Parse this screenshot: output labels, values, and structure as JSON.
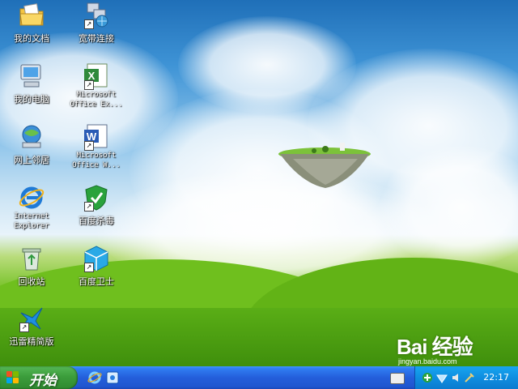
{
  "desktop_icons": [
    {
      "label": "我的文档",
      "icon": "my-documents-folder-icon",
      "shortcut": false
    },
    {
      "label": "宽带连接",
      "icon": "broadband-connection-icon",
      "shortcut": true
    },
    {
      "label": "我的电脑",
      "icon": "my-computer-icon",
      "shortcut": false
    },
    {
      "label": "Microsoft Office Ex...",
      "icon": "microsoft-excel-icon",
      "shortcut": true
    },
    {
      "label": "网上邻居",
      "icon": "network-places-icon",
      "shortcut": false
    },
    {
      "label": "Microsoft Office W...",
      "icon": "microsoft-word-icon",
      "shortcut": true
    },
    {
      "label": "Internet Explorer",
      "icon": "internet-explorer-icon",
      "shortcut": false
    },
    {
      "label": "百度杀毒",
      "icon": "baidu-antivirus-icon",
      "shortcut": true
    },
    {
      "label": "回收站",
      "icon": "recycle-bin-icon",
      "shortcut": false
    },
    {
      "label": "百度卫士",
      "icon": "baidu-guard-icon",
      "shortcut": true
    },
    {
      "label": "迅雷精简版",
      "icon": "xunlei-icon",
      "shortcut": true
    }
  ],
  "taskbar": {
    "start_label": "开始",
    "quick_launch": [
      "internet-explorer-icon",
      "show-desktop-icon"
    ],
    "tray_icons": [
      "keyboard-icon",
      "baidu-antivirus-tray-icon",
      "network-tray-icon",
      "volume-icon",
      "tools-icon"
    ],
    "clock": "22:17"
  },
  "watermark": {
    "brand": "Bai 经验",
    "url": "jingyan.baidu.com"
  },
  "colors": {
    "taskbar": "#245edb",
    "start_button": "#3c9d3c",
    "tray": "#0f8ee0"
  }
}
